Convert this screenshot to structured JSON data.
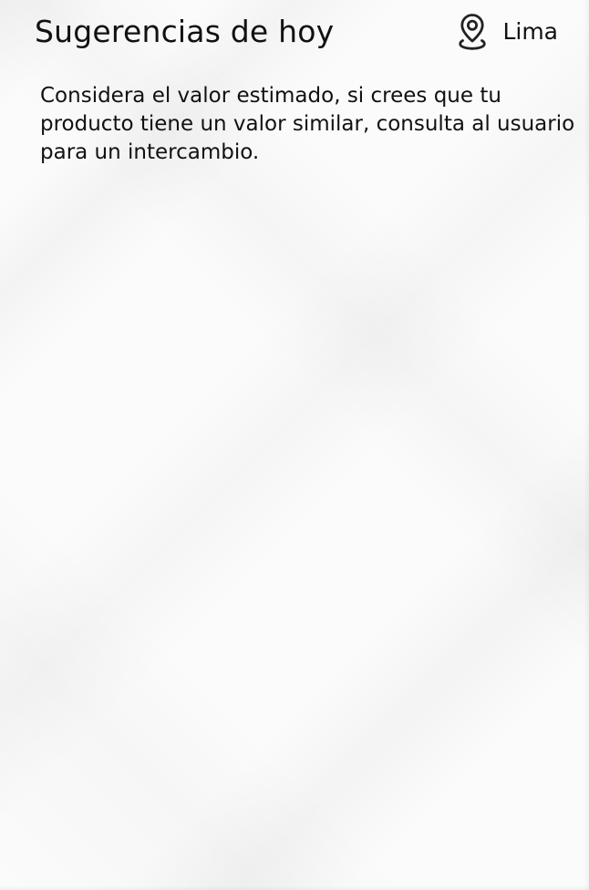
{
  "header": {
    "title": "Sugerencias de hoy",
    "location": {
      "label": "Lima",
      "icon": "location-pin-icon"
    }
  },
  "main": {
    "description": "Considera el valor estimado, si crees que tu producto tiene un valor similar, consulta al usuario para un intercambio."
  }
}
